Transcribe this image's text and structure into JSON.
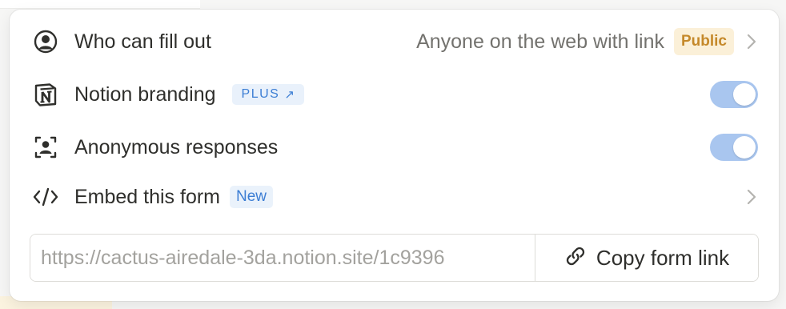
{
  "panel": {
    "who_can_fill": {
      "label": "Who can fill out",
      "value": "Anyone on the web with link",
      "badge": "Public",
      "icon": "user-circle-icon"
    },
    "branding": {
      "label": "Notion branding",
      "badge": "PLUS",
      "badge_arrow": "↗",
      "enabled": true,
      "icon": "notion-logo-icon"
    },
    "anonymous": {
      "label": "Anonymous responses",
      "enabled": true,
      "icon": "anonymous-user-icon"
    },
    "embed": {
      "label": "Embed this form",
      "badge": "New",
      "icon": "code-icon"
    },
    "link": {
      "url": "https://cactus-airedale-3da.notion.site/1c9396",
      "copy_label": "Copy form link",
      "icon": "link-icon"
    }
  },
  "colors": {
    "toggle_on": "#a9c6ef",
    "public_badge_bg": "#fbf0d8",
    "public_badge_text": "#c5892a",
    "blue_badge_text": "#3c7ed4"
  }
}
